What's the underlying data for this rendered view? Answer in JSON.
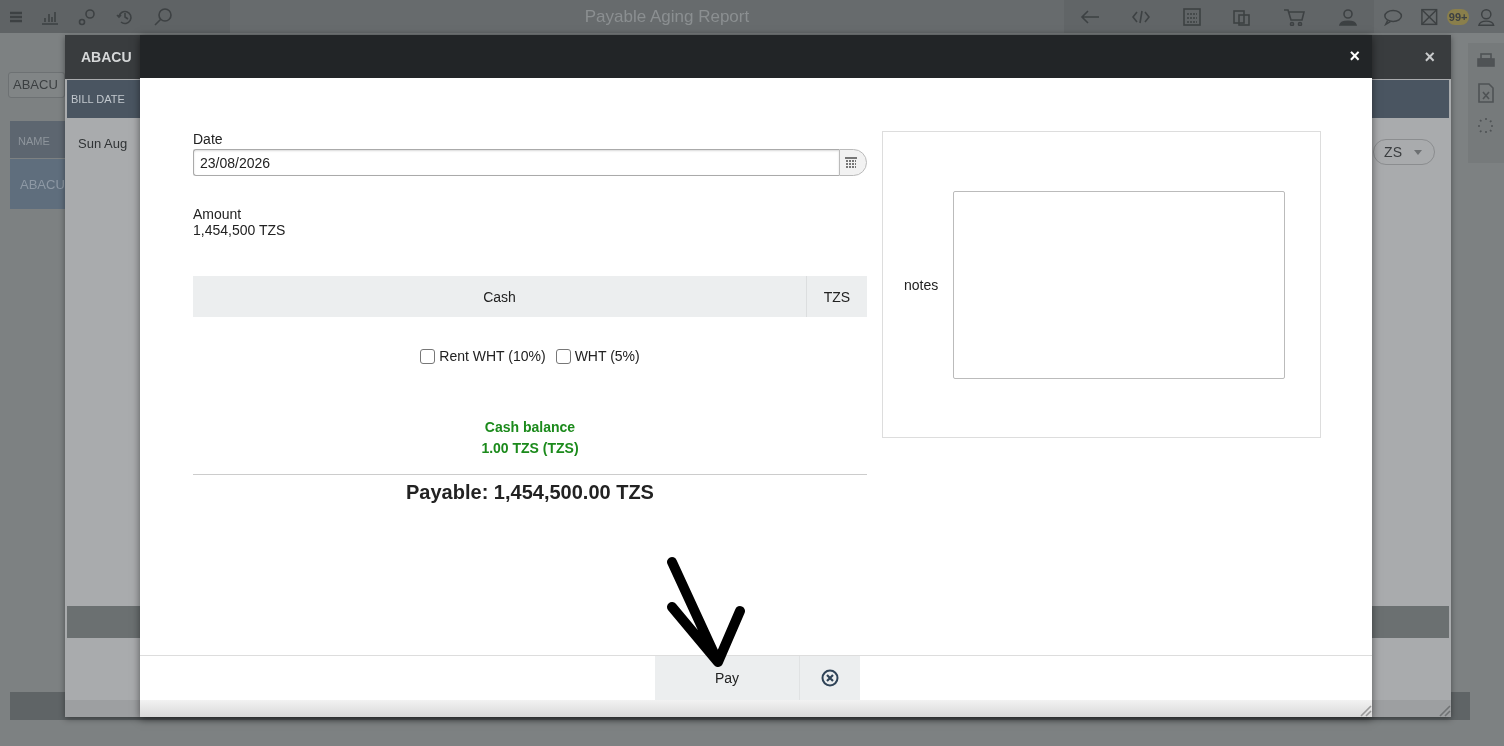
{
  "app": {
    "title": "Payable Aging Report",
    "notification_count": "99+",
    "filter_value": "ABACU",
    "table": {
      "columns": [
        "NAME"
      ],
      "rows": [
        "ABACU"
      ]
    }
  },
  "vendor_dialog": {
    "title": "ABACU",
    "close": "×",
    "columns": [
      "BILL DATE"
    ],
    "rows": [
      "Sun Aug"
    ],
    "currency_select": "ZS"
  },
  "payment_dialog": {
    "close": "×",
    "date": {
      "label": "Date",
      "value": "23/08/2026"
    },
    "amount": {
      "label": "Amount",
      "value": "1,454,500 TZS"
    },
    "account": {
      "name": "Cash",
      "currency": "TZS"
    },
    "options": [
      {
        "label": "Rent WHT (10%)",
        "checked": false
      },
      {
        "label": "WHT (5%)",
        "checked": false
      }
    ],
    "balance": {
      "label": "Cash balance",
      "value": "1.00 TZS (TZS)"
    },
    "payable": "Payable: 1,454,500.00 TZS",
    "notes": {
      "label": "notes"
    },
    "buttons": [
      "Pay"
    ]
  }
}
